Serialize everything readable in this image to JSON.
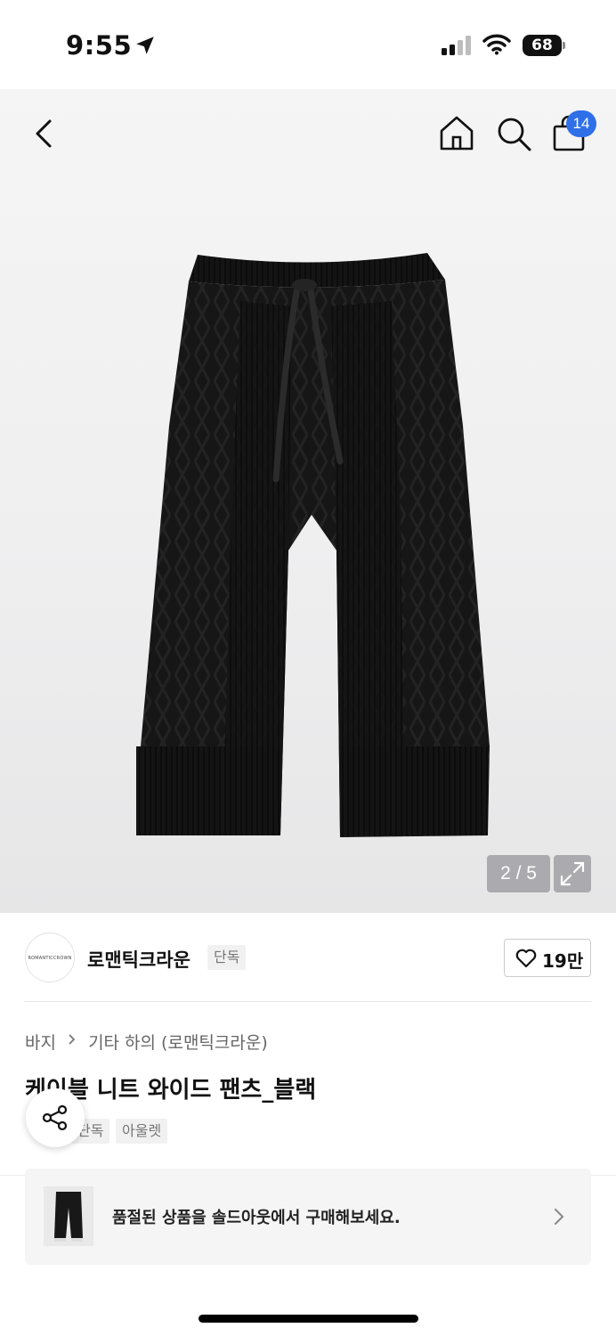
{
  "status_bar": {
    "time": "9:55",
    "battery": "68"
  },
  "header": {
    "cart_count": "14"
  },
  "gallery": {
    "pager": "2 / 5"
  },
  "brand": {
    "name": "로맨틱크라운",
    "logo_text": "ROMANTICCROWN",
    "tag": "단독",
    "likes": "19만"
  },
  "breadcrumb": {
    "category": "바지",
    "sub": "기타 하의 (로맨틱크라운)"
  },
  "product": {
    "title": "케이블 니트 와이드 팬츠_블랙",
    "tags": [
      "단독",
      "아울렛"
    ]
  },
  "soldout": {
    "text": "품절된 상품을 솔드아웃에서 구매해보세요."
  },
  "colors": {
    "accent": "#2f6fe8",
    "product": "#151515",
    "background": "#efeff0"
  }
}
